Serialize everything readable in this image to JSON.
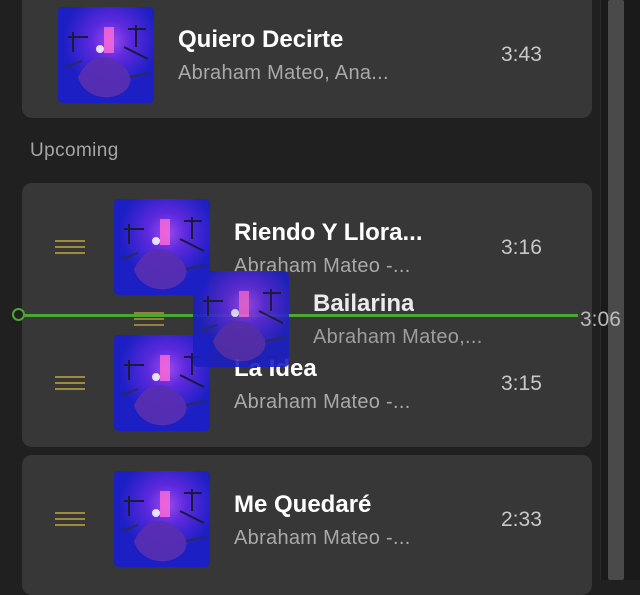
{
  "now_playing": {
    "title": "Quiero Decirte",
    "artist": "Abraham Mateo, Ana...",
    "duration": "3:43"
  },
  "section_label": "Upcoming",
  "queue": [
    {
      "title": "Riendo Y Llora...",
      "artist": "Abraham Mateo -...",
      "duration": "3:16"
    },
    {
      "title": "La Idea",
      "artist": "Abraham Mateo -...",
      "duration": "3:15"
    },
    {
      "title": "Me Quedaré",
      "artist": "Abraham Mateo -...",
      "duration": "2:33"
    }
  ],
  "dragging": {
    "title": "Bailarina",
    "artist": "Abraham Mateo,...",
    "duration": "3:06"
  },
  "colors": {
    "background": "#202020",
    "card": "#373737",
    "drop_indicator": "#4aa832",
    "drag_handle": "#a08a3c",
    "album_art": "#1b1fc4"
  },
  "icons": {
    "drag_handle": "drag-handle-icon",
    "album_art": "album-art-image"
  }
}
